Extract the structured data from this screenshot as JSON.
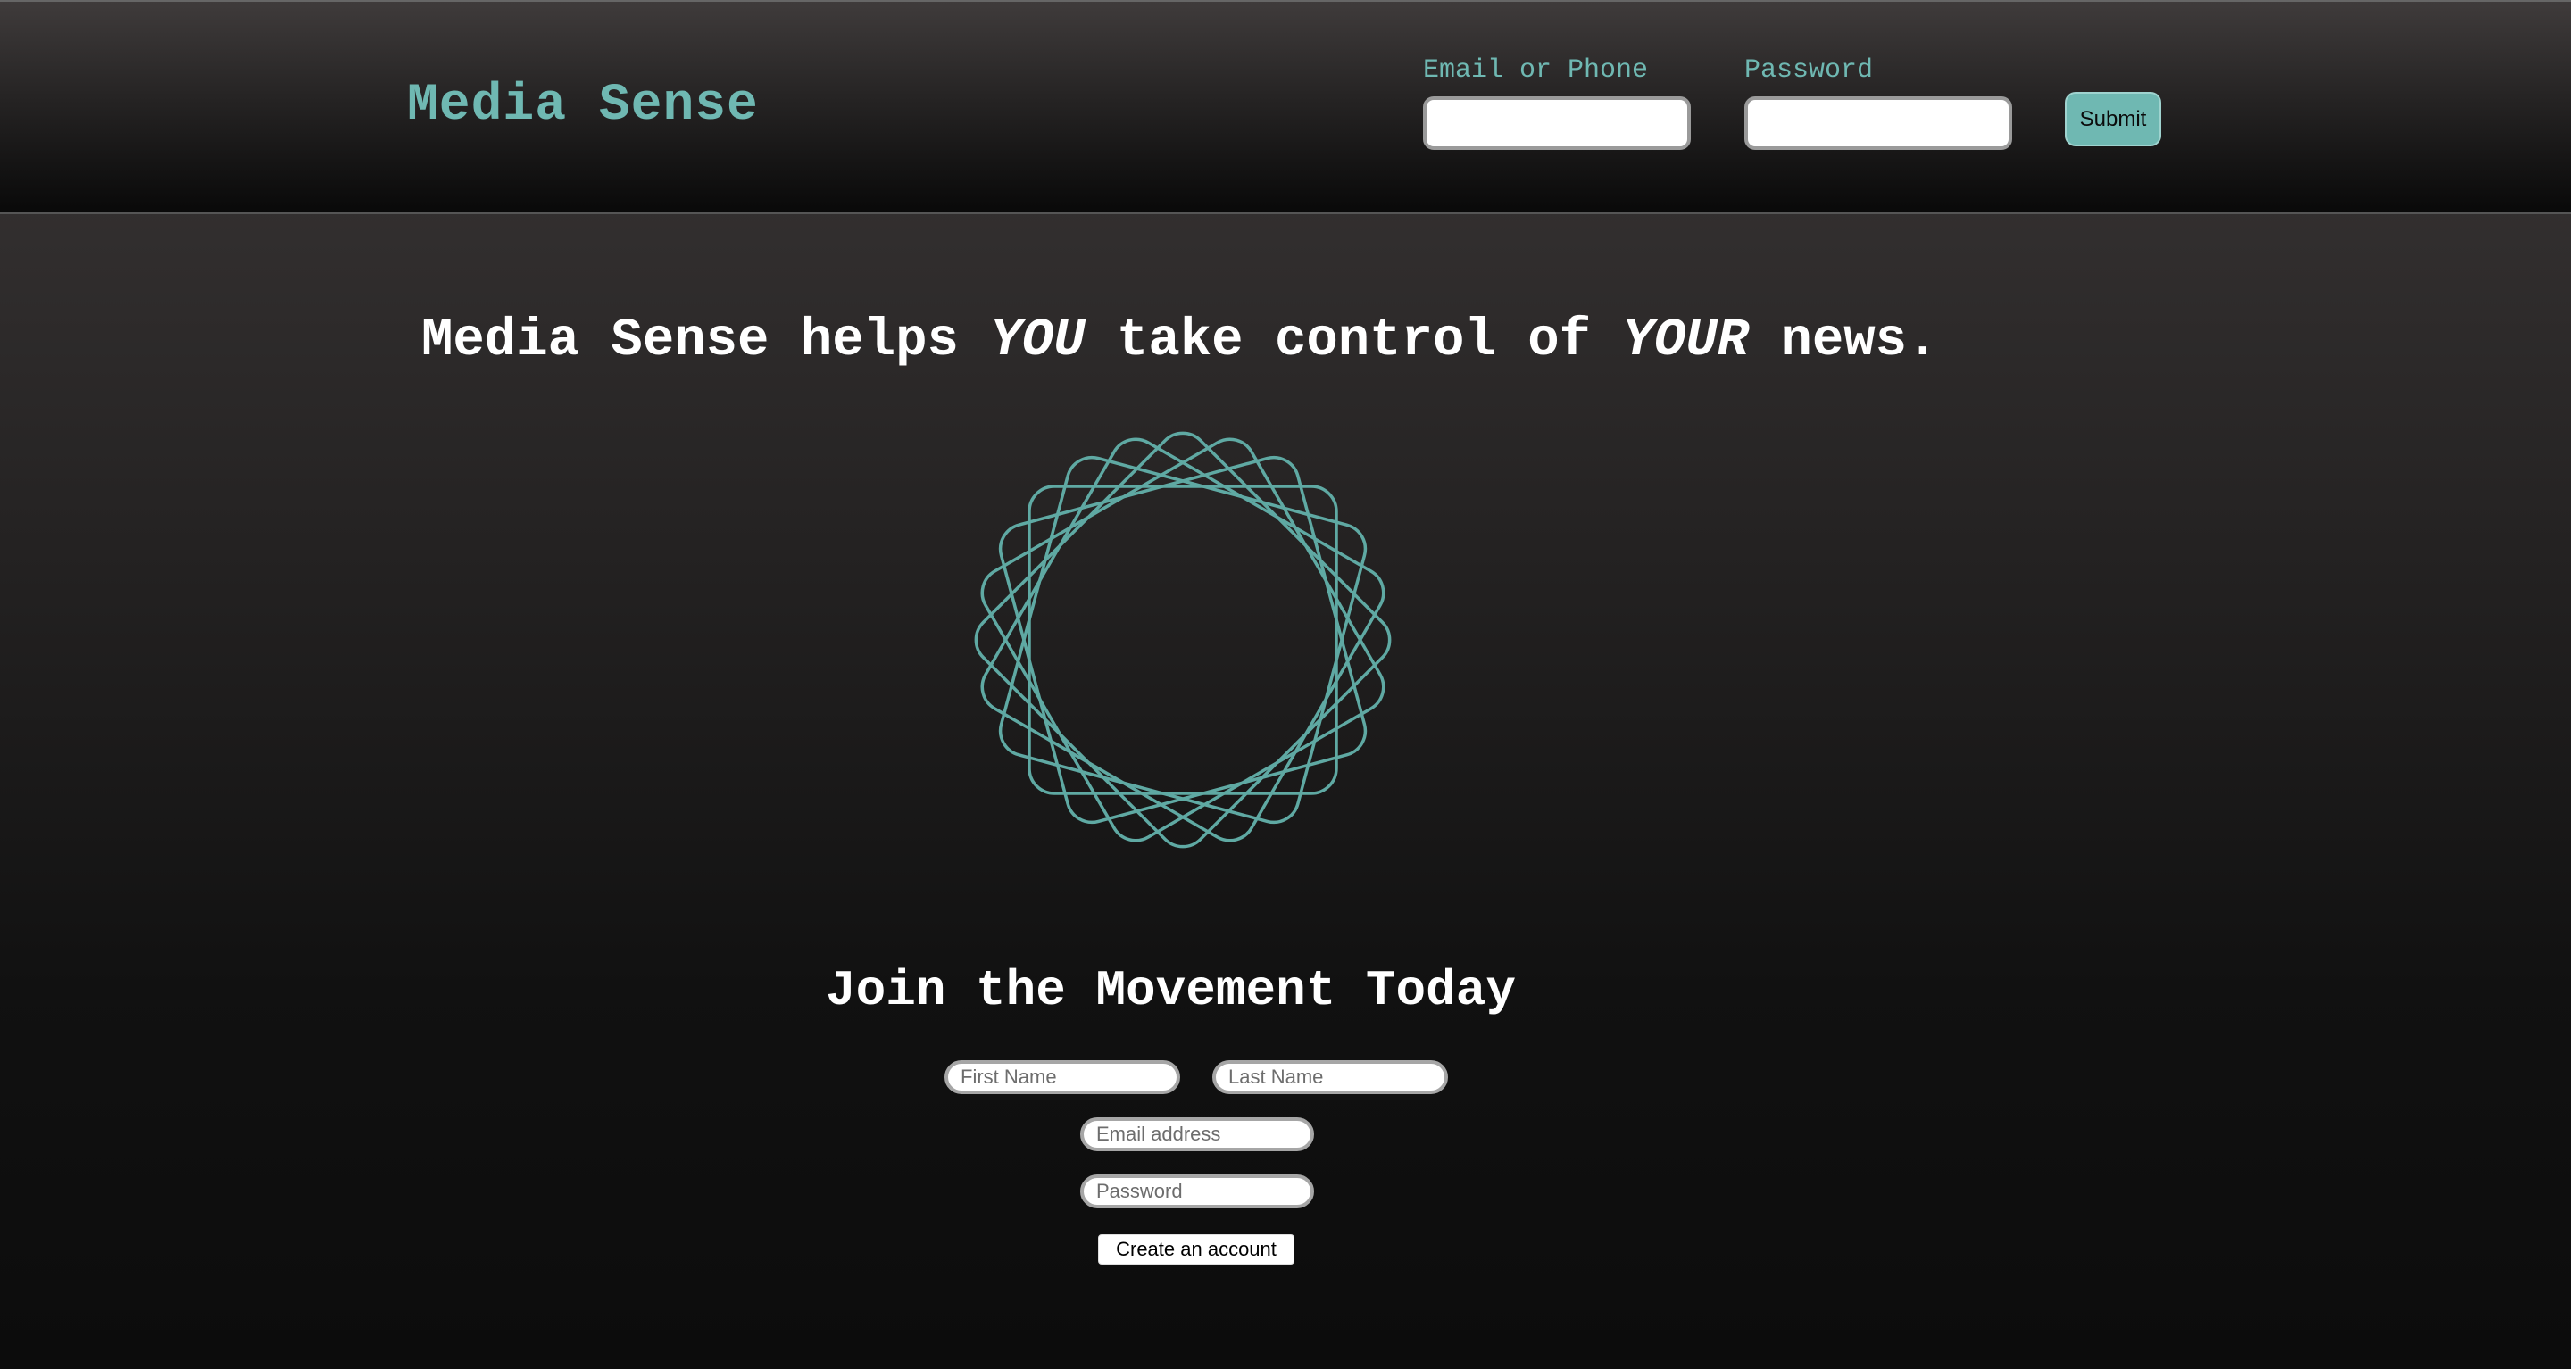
{
  "header": {
    "logo": "Media Sense",
    "login": {
      "email_label": "Email or Phone",
      "email_value": "",
      "password_label": "Password",
      "password_value": "",
      "submit_label": "Submit"
    }
  },
  "hero": {
    "headline_part1": "Media Sense helps ",
    "headline_em1": "YOU",
    "headline_part2": " take control of ",
    "headline_em2": "YOUR",
    "headline_part3": " news.",
    "graphic_icon": "spirograph-logo-icon",
    "graphic_color": "#5fa9a3"
  },
  "signup": {
    "title": "Join the Movement Today",
    "first_name_placeholder": "First Name",
    "last_name_placeholder": "Last Name",
    "email_placeholder": "Email address",
    "password_placeholder": "Password",
    "create_label": "Create an account"
  },
  "colors": {
    "accent": "#6fb8b2",
    "text": "#ffffff",
    "background_top": "#3b3737",
    "background_bottom": "#0c0c0c"
  }
}
